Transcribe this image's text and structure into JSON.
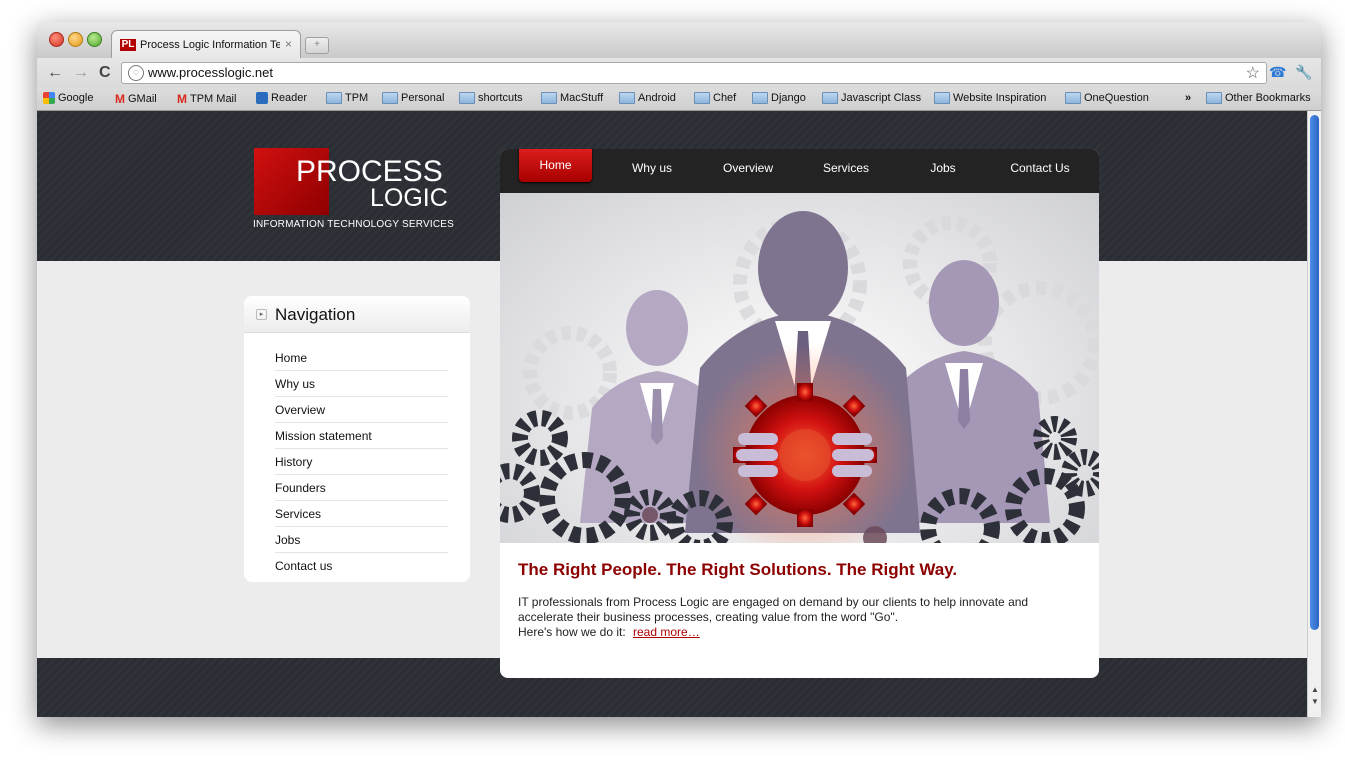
{
  "browser": {
    "tab_title": "Process Logic Information Te",
    "tab_favicon": "PL",
    "tab_close": "×",
    "new_tab": "+",
    "url": "www.processlogic.net",
    "back": "←",
    "forward": "→",
    "reload": "C",
    "star": "☆",
    "wrench": "🔧",
    "extension": "☎"
  },
  "bookmarks": {
    "items": [
      "Google",
      "GMail",
      "TPM Mail",
      "Reader",
      "TPM",
      "Personal",
      "shortcuts",
      "MacStuff",
      "Android",
      "Chef",
      "Django",
      "Javascript Class",
      "Website Inspiration",
      "OneQuestion"
    ],
    "overflow": "»",
    "other": "Other Bookmarks"
  },
  "site": {
    "logo_process": "PROCESS",
    "logo_logic": "LOGIC",
    "logo_tagline": "INFORMATION TECHNOLOGY SERVICES",
    "topnav": [
      "Home",
      "Why us",
      "Overview",
      "Services",
      "Jobs",
      "Contact Us"
    ],
    "sidebar_title": "Navigation",
    "sidebar_arrow": "▸",
    "sidebar_items": [
      "Home",
      "Why us",
      "Overview",
      "Mission statement",
      "History",
      "Founders",
      "Services",
      "Jobs",
      "Contact us"
    ],
    "headline": "The Right People.  The Right Solutions.  The Right Way.",
    "body_line1": "IT professionals from Process Logic are engaged on demand by our clients to help innovate and accelerate their business processes, creating value from the word \"Go\".",
    "body_line2": "Here's how we do it:",
    "read_more": "read more…"
  },
  "colors": {
    "brand_red": "#b00000",
    "headline_red": "#8c0000",
    "header_dark": "#2c3035"
  }
}
